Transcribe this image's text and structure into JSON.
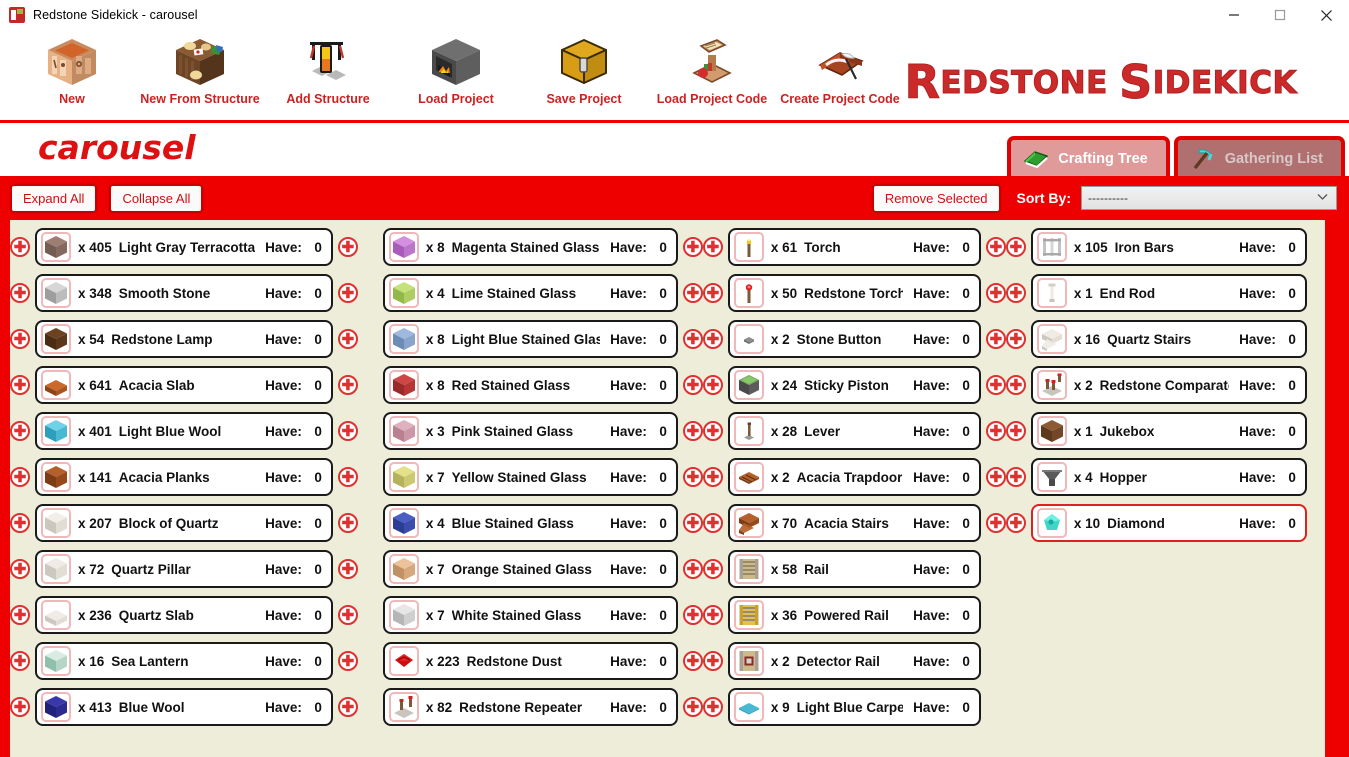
{
  "window": {
    "title": "Redstone Sidekick - carousel",
    "icon": "app-icon",
    "minimize": "—",
    "maximize": "□",
    "close": "✕"
  },
  "toolbar": {
    "items": [
      {
        "label": "New",
        "icon": "crafting-table-icon"
      },
      {
        "label": "New From Structure",
        "icon": "structure-block-icon"
      },
      {
        "label": "Add Structure",
        "icon": "redstone-lamp-stand-icon"
      },
      {
        "label": "Load Project",
        "icon": "furnace-icon"
      },
      {
        "label": "Save Project",
        "icon": "chest-icon"
      },
      {
        "label": "Load Project Code",
        "icon": "lectern-icon"
      },
      {
        "label": "Create Project Code",
        "icon": "book-and-quill-icon"
      }
    ],
    "logo_part1": "R",
    "logo_part2": "EDSTONE ",
    "logo_part3": "S",
    "logo_part4": "IDEKICK"
  },
  "project": {
    "name": "carousel"
  },
  "tabs": [
    {
      "label": "Crafting Tree",
      "icon": "green-book-icon",
      "active": true
    },
    {
      "label": "Gathering List",
      "icon": "pickaxe-icon",
      "active": false
    }
  ],
  "controls": {
    "expand_all": "Expand All",
    "collapse_all": "Collapse All",
    "remove_selected": "Remove Selected",
    "sort_by_label": "Sort By:",
    "sort_by_value": "----------",
    "sort_caret": "⌄",
    "plus_glyph": "✚",
    "scroll_marker": "⊕"
  },
  "have_label": "Have:",
  "columns": [
    {
      "name": "column-1",
      "rows": [
        {
          "qty": "x  405",
          "name": "Light Gray Terracotta",
          "have": "0",
          "icon": "light-gray-terracotta",
          "left_plus": true,
          "right_plus": true,
          "selected": false
        },
        {
          "qty": "x  348",
          "name": "Smooth Stone",
          "have": "0",
          "icon": "smooth-stone",
          "left_plus": true,
          "right_plus": true,
          "selected": false
        },
        {
          "qty": "x  54",
          "name": "Redstone Lamp",
          "have": "0",
          "icon": "redstone-lamp",
          "left_plus": true,
          "right_plus": true,
          "selected": false
        },
        {
          "qty": "x  641",
          "name": "Acacia Slab",
          "have": "0",
          "icon": "acacia-slab",
          "left_plus": true,
          "right_plus": true,
          "selected": false
        },
        {
          "qty": "x  401",
          "name": "Light Blue Wool",
          "have": "0",
          "icon": "light-blue-wool",
          "left_plus": true,
          "right_plus": true,
          "selected": false
        },
        {
          "qty": "x  141",
          "name": "Acacia Planks",
          "have": "0",
          "icon": "acacia-planks",
          "left_plus": true,
          "right_plus": true,
          "selected": false
        },
        {
          "qty": "x  207",
          "name": "Block of Quartz",
          "have": "0",
          "icon": "block-of-quartz",
          "left_plus": true,
          "right_plus": true,
          "selected": false
        },
        {
          "qty": "x  72",
          "name": "Quartz Pillar",
          "have": "0",
          "icon": "quartz-pillar",
          "left_plus": true,
          "right_plus": true,
          "selected": false
        },
        {
          "qty": "x  236",
          "name": "Quartz Slab",
          "have": "0",
          "icon": "quartz-slab",
          "left_plus": true,
          "right_plus": true,
          "selected": false
        },
        {
          "qty": "x  16",
          "name": "Sea Lantern",
          "have": "0",
          "icon": "sea-lantern",
          "left_plus": true,
          "right_plus": true,
          "selected": false
        },
        {
          "qty": "x  413",
          "name": "Blue Wool",
          "have": "0",
          "icon": "blue-wool",
          "left_plus": true,
          "right_plus": true,
          "selected": false
        }
      ]
    },
    {
      "name": "column-2",
      "rows": [
        {
          "qty": "x  8",
          "name": "Magenta Stained Glass",
          "have": "0",
          "icon": "magenta-stained-glass",
          "left_plus": false,
          "right_plus": true,
          "selected": false
        },
        {
          "qty": "x  4",
          "name": "Lime Stained Glass",
          "have": "0",
          "icon": "lime-stained-glass",
          "left_plus": false,
          "right_plus": true,
          "selected": false
        },
        {
          "qty": "x  8",
          "name": "Light Blue Stained Glass",
          "have": "0",
          "icon": "light-blue-stained-glass",
          "left_plus": false,
          "right_plus": true,
          "selected": false
        },
        {
          "qty": "x  8",
          "name": "Red Stained Glass",
          "have": "0",
          "icon": "red-stained-glass",
          "left_plus": false,
          "right_plus": true,
          "selected": false
        },
        {
          "qty": "x  3",
          "name": "Pink Stained Glass",
          "have": "0",
          "icon": "pink-stained-glass",
          "left_plus": false,
          "right_plus": true,
          "selected": false
        },
        {
          "qty": "x  7",
          "name": "Yellow Stained Glass",
          "have": "0",
          "icon": "yellow-stained-glass",
          "left_plus": false,
          "right_plus": true,
          "selected": false
        },
        {
          "qty": "x  4",
          "name": "Blue Stained Glass",
          "have": "0",
          "icon": "blue-stained-glass",
          "left_plus": false,
          "right_plus": true,
          "selected": false
        },
        {
          "qty": "x  7",
          "name": "Orange Stained Glass",
          "have": "0",
          "icon": "orange-stained-glass",
          "left_plus": false,
          "right_plus": true,
          "selected": false
        },
        {
          "qty": "x  7",
          "name": "White Stained Glass",
          "have": "0",
          "icon": "white-stained-glass",
          "left_plus": false,
          "right_plus": true,
          "selected": false
        },
        {
          "qty": "x  223",
          "name": "Redstone Dust",
          "have": "0",
          "icon": "redstone-dust",
          "left_plus": false,
          "right_plus": true,
          "selected": false
        },
        {
          "qty": "x  82",
          "name": "Redstone Repeater",
          "have": "0",
          "icon": "redstone-repeater",
          "left_plus": false,
          "right_plus": true,
          "selected": false
        }
      ]
    },
    {
      "name": "column-3",
      "rows": [
        {
          "qty": "x  61",
          "name": "Torch",
          "have": "0",
          "icon": "torch",
          "left_plus": true,
          "right_plus": true,
          "selected": false
        },
        {
          "qty": "x  50",
          "name": "Redstone Torch",
          "have": "0",
          "icon": "redstone-torch",
          "left_plus": true,
          "right_plus": true,
          "selected": false
        },
        {
          "qty": "x  2",
          "name": "Stone Button",
          "have": "0",
          "icon": "stone-button",
          "left_plus": true,
          "right_plus": true,
          "selected": false
        },
        {
          "qty": "x  24",
          "name": "Sticky Piston",
          "have": "0",
          "icon": "sticky-piston",
          "left_plus": true,
          "right_plus": true,
          "selected": false
        },
        {
          "qty": "x  28",
          "name": "Lever",
          "have": "0",
          "icon": "lever",
          "left_plus": true,
          "right_plus": true,
          "selected": false
        },
        {
          "qty": "x  2",
          "name": "Acacia Trapdoor",
          "have": "0",
          "icon": "acacia-trapdoor",
          "left_plus": true,
          "right_plus": true,
          "selected": false
        },
        {
          "qty": "x  70",
          "name": "Acacia Stairs",
          "have": "0",
          "icon": "acacia-stairs",
          "left_plus": true,
          "right_plus": true,
          "selected": false
        },
        {
          "qty": "x  58",
          "name": "Rail",
          "have": "0",
          "icon": "rail",
          "left_plus": true,
          "right_plus": false,
          "selected": false
        },
        {
          "qty": "x  36",
          "name": "Powered Rail",
          "have": "0",
          "icon": "powered-rail",
          "left_plus": true,
          "right_plus": false,
          "selected": false
        },
        {
          "qty": "x  2",
          "name": "Detector Rail",
          "have": "0",
          "icon": "detector-rail",
          "left_plus": true,
          "right_plus": false,
          "selected": false
        },
        {
          "qty": "x  9",
          "name": "Light Blue Carpet",
          "have": "0",
          "icon": "light-blue-carpet",
          "left_plus": true,
          "right_plus": false,
          "selected": false
        }
      ]
    },
    {
      "name": "column-4",
      "rows": [
        {
          "qty": "x  105",
          "name": "Iron Bars",
          "have": "0",
          "icon": "iron-bars",
          "left_plus": true,
          "right_plus": false,
          "selected": false
        },
        {
          "qty": "x  1",
          "name": "End Rod",
          "have": "0",
          "icon": "end-rod",
          "left_plus": true,
          "right_plus": false,
          "selected": false
        },
        {
          "qty": "x  16",
          "name": "Quartz Stairs",
          "have": "0",
          "icon": "quartz-stairs",
          "left_plus": true,
          "right_plus": false,
          "selected": false
        },
        {
          "qty": "x  2",
          "name": "Redstone Comparator",
          "have": "0",
          "icon": "redstone-comparator",
          "left_plus": true,
          "right_plus": false,
          "selected": false
        },
        {
          "qty": "x  1",
          "name": "Jukebox",
          "have": "0",
          "icon": "jukebox",
          "left_plus": true,
          "right_plus": false,
          "selected": false
        },
        {
          "qty": "x  4",
          "name": "Hopper",
          "have": "0",
          "icon": "hopper",
          "left_plus": true,
          "right_plus": false,
          "selected": false
        },
        {
          "qty": "x  10",
          "name": "Diamond",
          "have": "0",
          "icon": "diamond",
          "left_plus": true,
          "right_plus": false,
          "selected": true
        }
      ]
    }
  ],
  "colors": {
    "brand_red": "#ee0000",
    "logo_red": "#cc2a2a",
    "list_bg": "#ededd9",
    "card_border": "#1a1a1a",
    "selected_border": "#dd2222",
    "icon_frame": "#f0b8b8"
  }
}
